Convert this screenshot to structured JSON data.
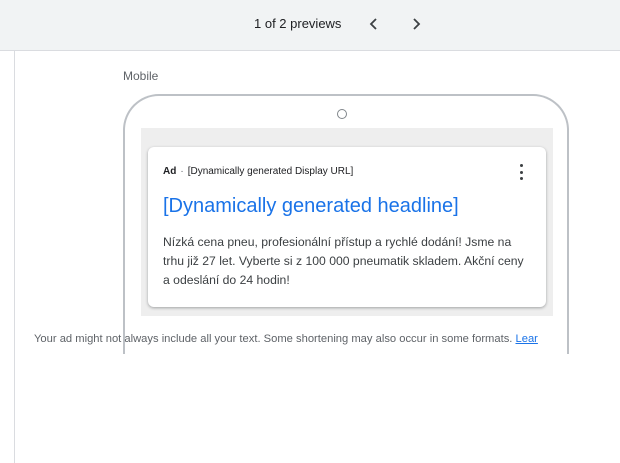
{
  "preview_nav": {
    "counter": "1 of 2 previews",
    "prev_icon": "chevron-left-icon",
    "next_icon": "chevron-right-icon"
  },
  "device": {
    "label": "Mobile"
  },
  "ad": {
    "badge": "Ad",
    "separator": "·",
    "display_url": "[Dynamically generated Display URL]",
    "menu_icon": "more-vert-icon",
    "headline": "[Dynamically generated headline]",
    "description": "Nízká cena pneu, profesionální přístup a rychlé dodání! Jsme na trhu již 27 let. Vyberte si z 100 000 pneumatik skladem. Akční ceny a odeslání do 24 hodin!"
  },
  "footer": {
    "note": "Your ad might not always include all your text. Some shortening may also occur in some formats.",
    "link": "Lear"
  },
  "colors": {
    "link_blue": "#1a73e8",
    "topbar_bg": "#f1f3f4",
    "screen_bg": "#eeeeee"
  }
}
